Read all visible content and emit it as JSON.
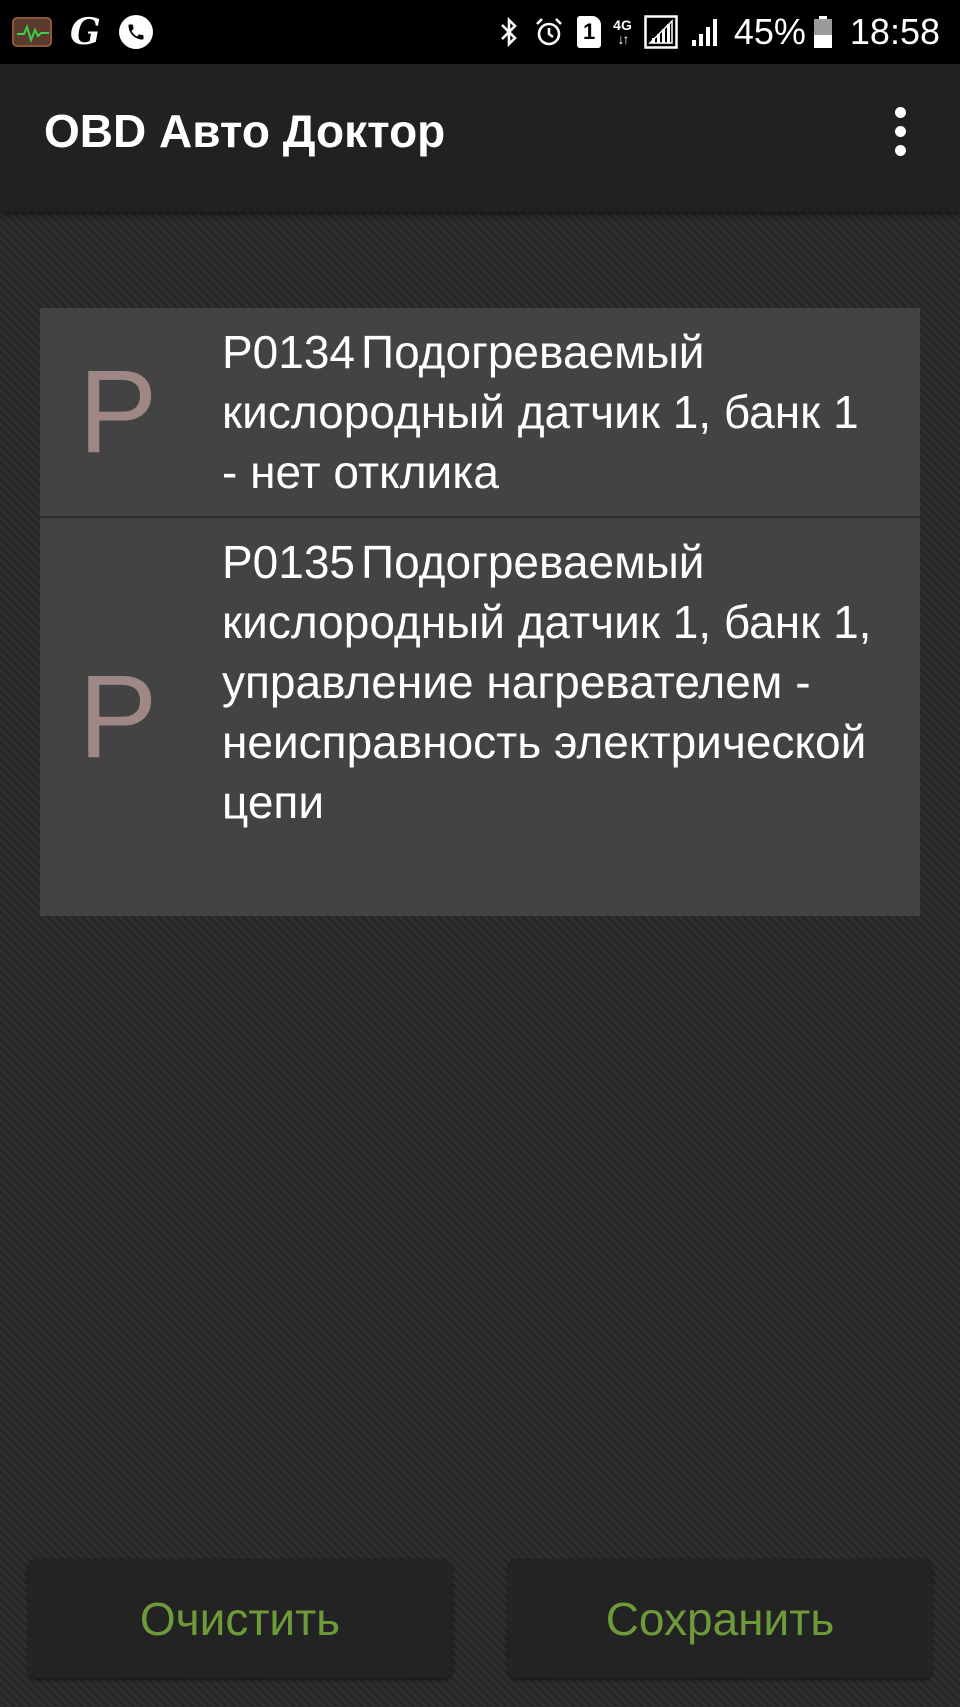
{
  "status_bar": {
    "notification_icons": [
      "obd-app-icon",
      "g-icon",
      "call-icon"
    ],
    "g_glyph": "G",
    "system_icons": [
      "bluetooth-icon",
      "alarm-icon",
      "sim-icon",
      "network-type-icon",
      "wifi-signal-icon",
      "cell-signal-icon",
      "battery-icon"
    ],
    "sim_number": "1",
    "network_type": "4G",
    "network_arrows": "↓↑",
    "battery_percent": "45%",
    "battery_level": 0.45,
    "time": "18:58"
  },
  "app_bar": {
    "title": "OBD Авто Доктор",
    "menu_icon": "more-vert-icon"
  },
  "dtc_list": [
    {
      "letter": "P",
      "code": "P0134",
      "description": "Подогреваемый кислородный датчик 1, банк 1 - нет отклика"
    },
    {
      "letter": "P",
      "code": "P0135",
      "description": "Подогреваемый кислородный датчик 1, банк 1, управление нагревателем - неисправность электрической цепи"
    }
  ],
  "buttons": {
    "clear_label": "Очистить",
    "save_label": "Сохранить",
    "label_color": "#6e9a3a"
  },
  "colors": {
    "letter_color": "#9e8784",
    "row_background": "#434343",
    "app_bar_background": "#212121"
  }
}
